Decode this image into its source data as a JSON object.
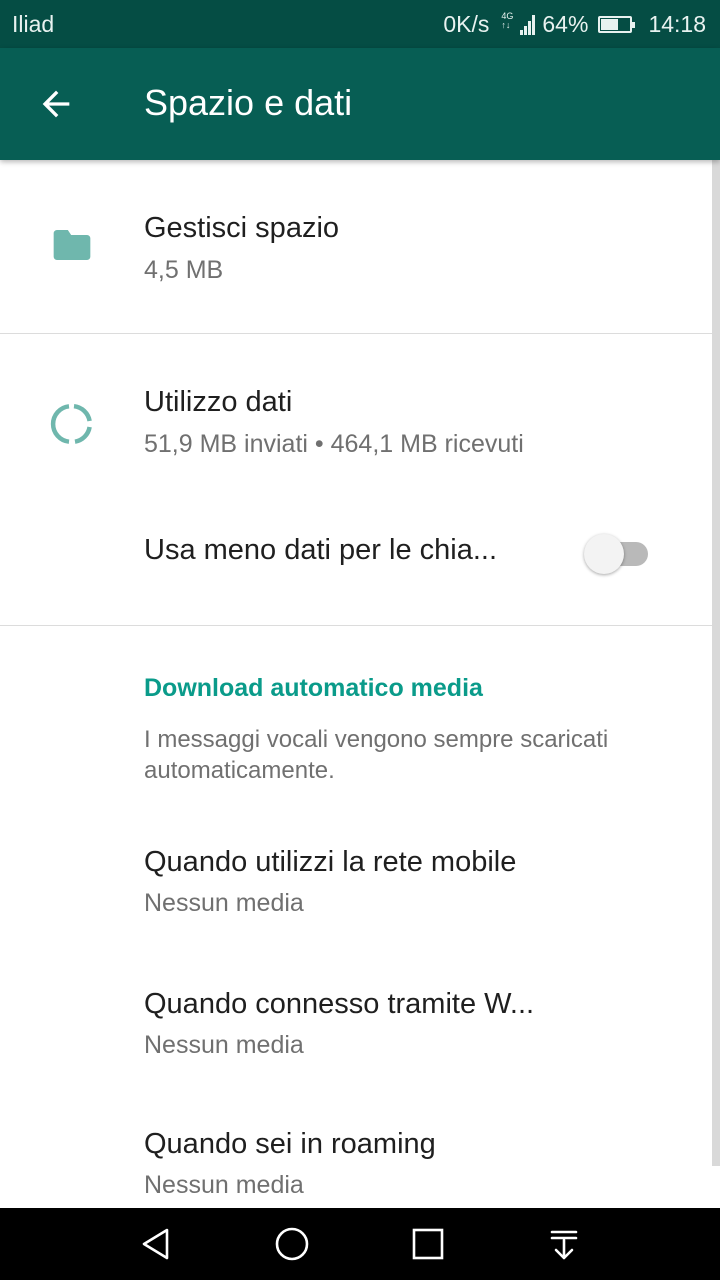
{
  "status_bar": {
    "carrier": "Iliad",
    "net_speed": "0K/s",
    "network_type": "4G",
    "network_sub": "↑↓",
    "battery_percent": "64%",
    "battery_level": 0.64,
    "time": "14:18"
  },
  "app_bar": {
    "title": "Spazio e dati",
    "back_icon": "arrow-left-icon"
  },
  "storage": {
    "title": "Gestisci spazio",
    "subtitle": "4,5 MB",
    "icon": "folder-icon"
  },
  "data_usage": {
    "title": "Utilizzo dati",
    "subtitle": "51,9 MB inviati • 464,1 MB ricevuti",
    "icon": "data-usage-icon"
  },
  "low_data_calls": {
    "label": "Usa meno dati per le chia...",
    "enabled": false
  },
  "auto_download": {
    "header": "Download automatico media",
    "note": "I messaggi vocali vengono sempre scaricati automaticamente.",
    "items": [
      {
        "title": "Quando utilizzi la rete mobile",
        "value": "Nessun media"
      },
      {
        "title": "Quando connesso tramite W...",
        "value": "Nessun media"
      },
      {
        "title": "Quando sei in roaming",
        "value": "Nessun media"
      }
    ]
  },
  "nav_bar": {
    "back": "nav-back-icon",
    "home": "nav-home-icon",
    "recents": "nav-recents-icon",
    "notifications": "nav-notification-pull-icon"
  },
  "colors": {
    "status_bar": "#054d44",
    "app_bar": "#075e54",
    "accent": "#0a9b8a",
    "icon_tint": "#6fb7ad"
  }
}
